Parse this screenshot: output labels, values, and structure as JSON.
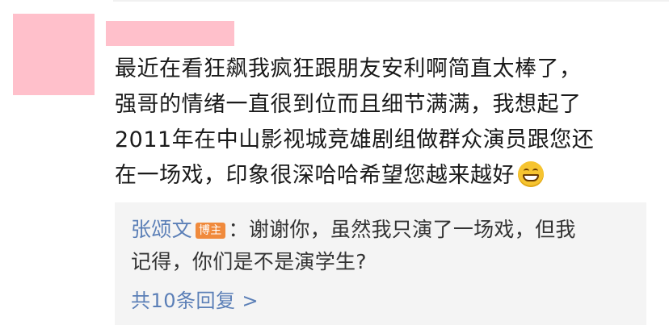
{
  "comment": {
    "lines": [
      "最近在看狂飙我疯狂跟朋友安利啊简直太棒了，",
      "强哥的情绪一直很到位而且细节满满，我想起了",
      "2011年在中山影视城竞雄剧组做群众演员跟您还",
      "在一场戏，印象很深哈哈希望您越来越好"
    ],
    "emoji_icon": "grinning-face-icon"
  },
  "reply": {
    "author": "张颂文",
    "badge": "博主",
    "line1": "：谢谢你，虽然我只演了一场戏，但我",
    "line2": "记得，你们是不是演学生?",
    "view_more": "共10条回复",
    "view_more_icon": "chevron-right-icon"
  },
  "colors": {
    "redaction": "#ffc0cb",
    "link": "#5b7fb7",
    "badge": "#f08a3c",
    "reply_bg": "#f4f4f4"
  }
}
